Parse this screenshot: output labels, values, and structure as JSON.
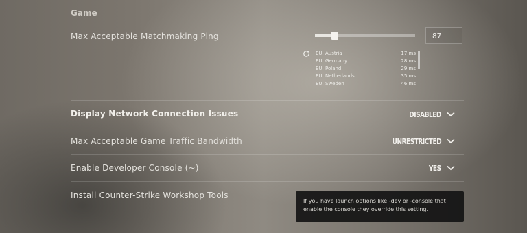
{
  "section": {
    "title": "Game"
  },
  "matchmaking_ping": {
    "label": "Max Acceptable Matchmaking Ping",
    "value": "87",
    "slider_fraction": 0.2,
    "servers": [
      {
        "name": "EU, Austria",
        "ping": "17 ms"
      },
      {
        "name": "EU, Germany",
        "ping": "28 ms"
      },
      {
        "name": "EU, Poland",
        "ping": "29 ms"
      },
      {
        "name": "EU, Netherlands",
        "ping": "35 ms"
      },
      {
        "name": "EU, Sweden",
        "ping": "46 ms"
      }
    ]
  },
  "network_issues": {
    "label": "Display Network Connection Issues",
    "value": "DISABLED"
  },
  "bandwidth": {
    "label": "Max Acceptable Game Traffic Bandwidth",
    "value": "UNRESTRICTED"
  },
  "dev_console": {
    "label": "Enable Developer Console (~)",
    "value": "YES"
  },
  "workshop_tools": {
    "label": "Install Counter-Strike Workshop Tools"
  },
  "tooltip": {
    "line1": "If you have launch options like -dev or -console that",
    "line2": "enable the console they override this setting."
  },
  "icons": {
    "refresh": "refresh-icon",
    "dropdown": "chevron-down-icon"
  }
}
